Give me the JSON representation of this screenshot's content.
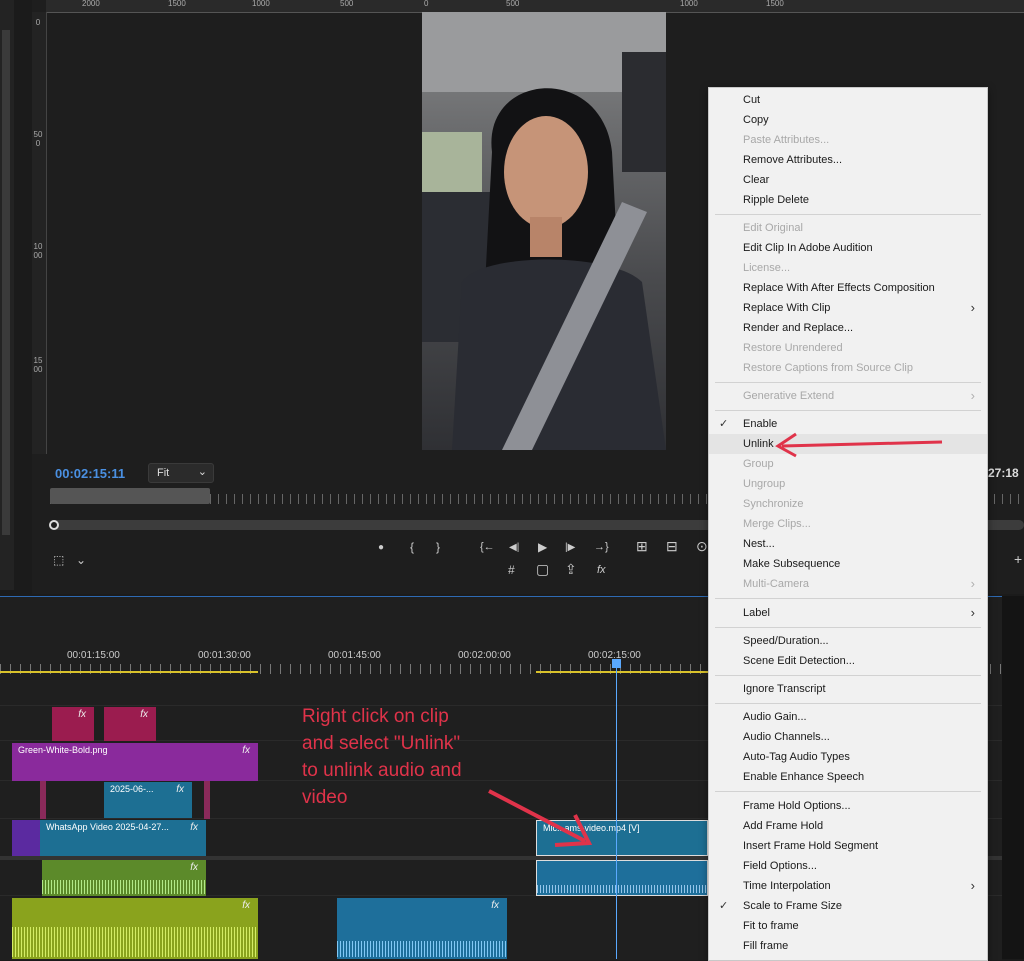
{
  "program_monitor": {
    "top_ruler_labels": [
      "2000",
      "1500",
      "1000",
      "500",
      "0",
      "500",
      "1000",
      "1500"
    ],
    "side_ruler_labels": [
      "0",
      "500",
      "1000",
      "1500"
    ],
    "timecode_current": "00:02:15:11",
    "timecode_end": "27:18",
    "fit_value": "Fit",
    "fit_chevron_icon": "chevron-down-icon"
  },
  "transport": {
    "row1_icons": [
      "marker-icon",
      "mark-in-icon",
      "mark-out-icon",
      "go-to-in-icon",
      "step-back-icon",
      "play-icon",
      "step-forward-icon",
      "go-to-out-icon",
      "lift-icon",
      "extract-icon",
      "export-frame-icon"
    ],
    "row2_icons": [
      "safe-margins-icon",
      "comparison-view-icon",
      "export-icon",
      "fx-icon"
    ],
    "glyphs": {
      "marker": "●",
      "mark_in": "{",
      "mark_out": "}",
      "go_in": "{←",
      "step_back": "◀|",
      "play": "▶",
      "step_fwd": "|▶",
      "go_out": "→}",
      "lift": "⊞",
      "extract": "⊟",
      "camera": "⊙",
      "grid": "#",
      "safe": "▢",
      "export": "⇪",
      "fx": "fx",
      "plus": "+"
    }
  },
  "timeline": {
    "timecodes": [
      "00:01:15:00",
      "00:01:30:00",
      "00:01:45:00",
      "00:02:00:00",
      "00:02:15:00"
    ],
    "clips": {
      "green_white_bold": "Green-White-Bold.png",
      "clip_2025_06": "2025-06-...",
      "whatsapp_video": "WhatsApp Video 2025-04-27...",
      "micro_dreams_video": "Mic...ams-video.mp4 [V]",
      "fx": "fx"
    }
  },
  "annotation": {
    "text": "Right click on clip\nand select \"Unlink\"\nto unlink audio and\nvideo",
    "color": "#e0334a"
  },
  "context_menu": {
    "items": [
      {
        "label": "Cut",
        "enabled": true
      },
      {
        "label": "Copy",
        "enabled": true
      },
      {
        "label": "Paste Attributes...",
        "enabled": false
      },
      {
        "label": "Remove Attributes...",
        "enabled": true
      },
      {
        "label": "Clear",
        "enabled": true
      },
      {
        "label": "Ripple Delete",
        "enabled": true
      },
      {
        "label": "Edit Original",
        "enabled": false
      },
      {
        "label": "Edit Clip In Adobe Audition",
        "enabled": true
      },
      {
        "label": "License...",
        "enabled": false
      },
      {
        "label": "Replace With After Effects Composition",
        "enabled": true
      },
      {
        "label": "Replace With Clip",
        "enabled": true,
        "submenu": true
      },
      {
        "label": "Render and Replace...",
        "enabled": true
      },
      {
        "label": "Restore Unrendered",
        "enabled": false
      },
      {
        "label": "Restore Captions from Source Clip",
        "enabled": false
      },
      {
        "label": "Generative Extend",
        "enabled": false,
        "submenu": true
      },
      {
        "label": "Enable",
        "enabled": true,
        "checked": true
      },
      {
        "label": "Unlink",
        "enabled": true,
        "highlighted": true
      },
      {
        "label": "Group",
        "enabled": false
      },
      {
        "label": "Ungroup",
        "enabled": false
      },
      {
        "label": "Synchronize",
        "enabled": false
      },
      {
        "label": "Merge Clips...",
        "enabled": false
      },
      {
        "label": "Nest...",
        "enabled": true
      },
      {
        "label": "Make Subsequence",
        "enabled": true
      },
      {
        "label": "Multi-Camera",
        "enabled": false,
        "submenu": true
      },
      {
        "label": "Label",
        "enabled": true,
        "submenu": true
      },
      {
        "label": "Speed/Duration...",
        "enabled": true
      },
      {
        "label": "Scene Edit Detection...",
        "enabled": true
      },
      {
        "label": "Ignore Transcript",
        "enabled": true
      },
      {
        "label": "Audio Gain...",
        "enabled": true
      },
      {
        "label": "Audio Channels...",
        "enabled": true
      },
      {
        "label": "Auto-Tag Audio Types",
        "enabled": true
      },
      {
        "label": "Enable Enhance Speech",
        "enabled": true
      },
      {
        "label": "Frame Hold Options...",
        "enabled": true
      },
      {
        "label": "Add Frame Hold",
        "enabled": true
      },
      {
        "label": "Insert Frame Hold Segment",
        "enabled": true
      },
      {
        "label": "Field Options...",
        "enabled": true
      },
      {
        "label": "Time Interpolation",
        "enabled": true,
        "submenu": true
      },
      {
        "label": "Scale to Frame Size",
        "enabled": true,
        "checked": true
      },
      {
        "label": "Fit to frame",
        "enabled": true
      },
      {
        "label": "Fill frame",
        "enabled": true
      }
    ],
    "check_glyph": "✓",
    "submenu_glyph": "›"
  }
}
